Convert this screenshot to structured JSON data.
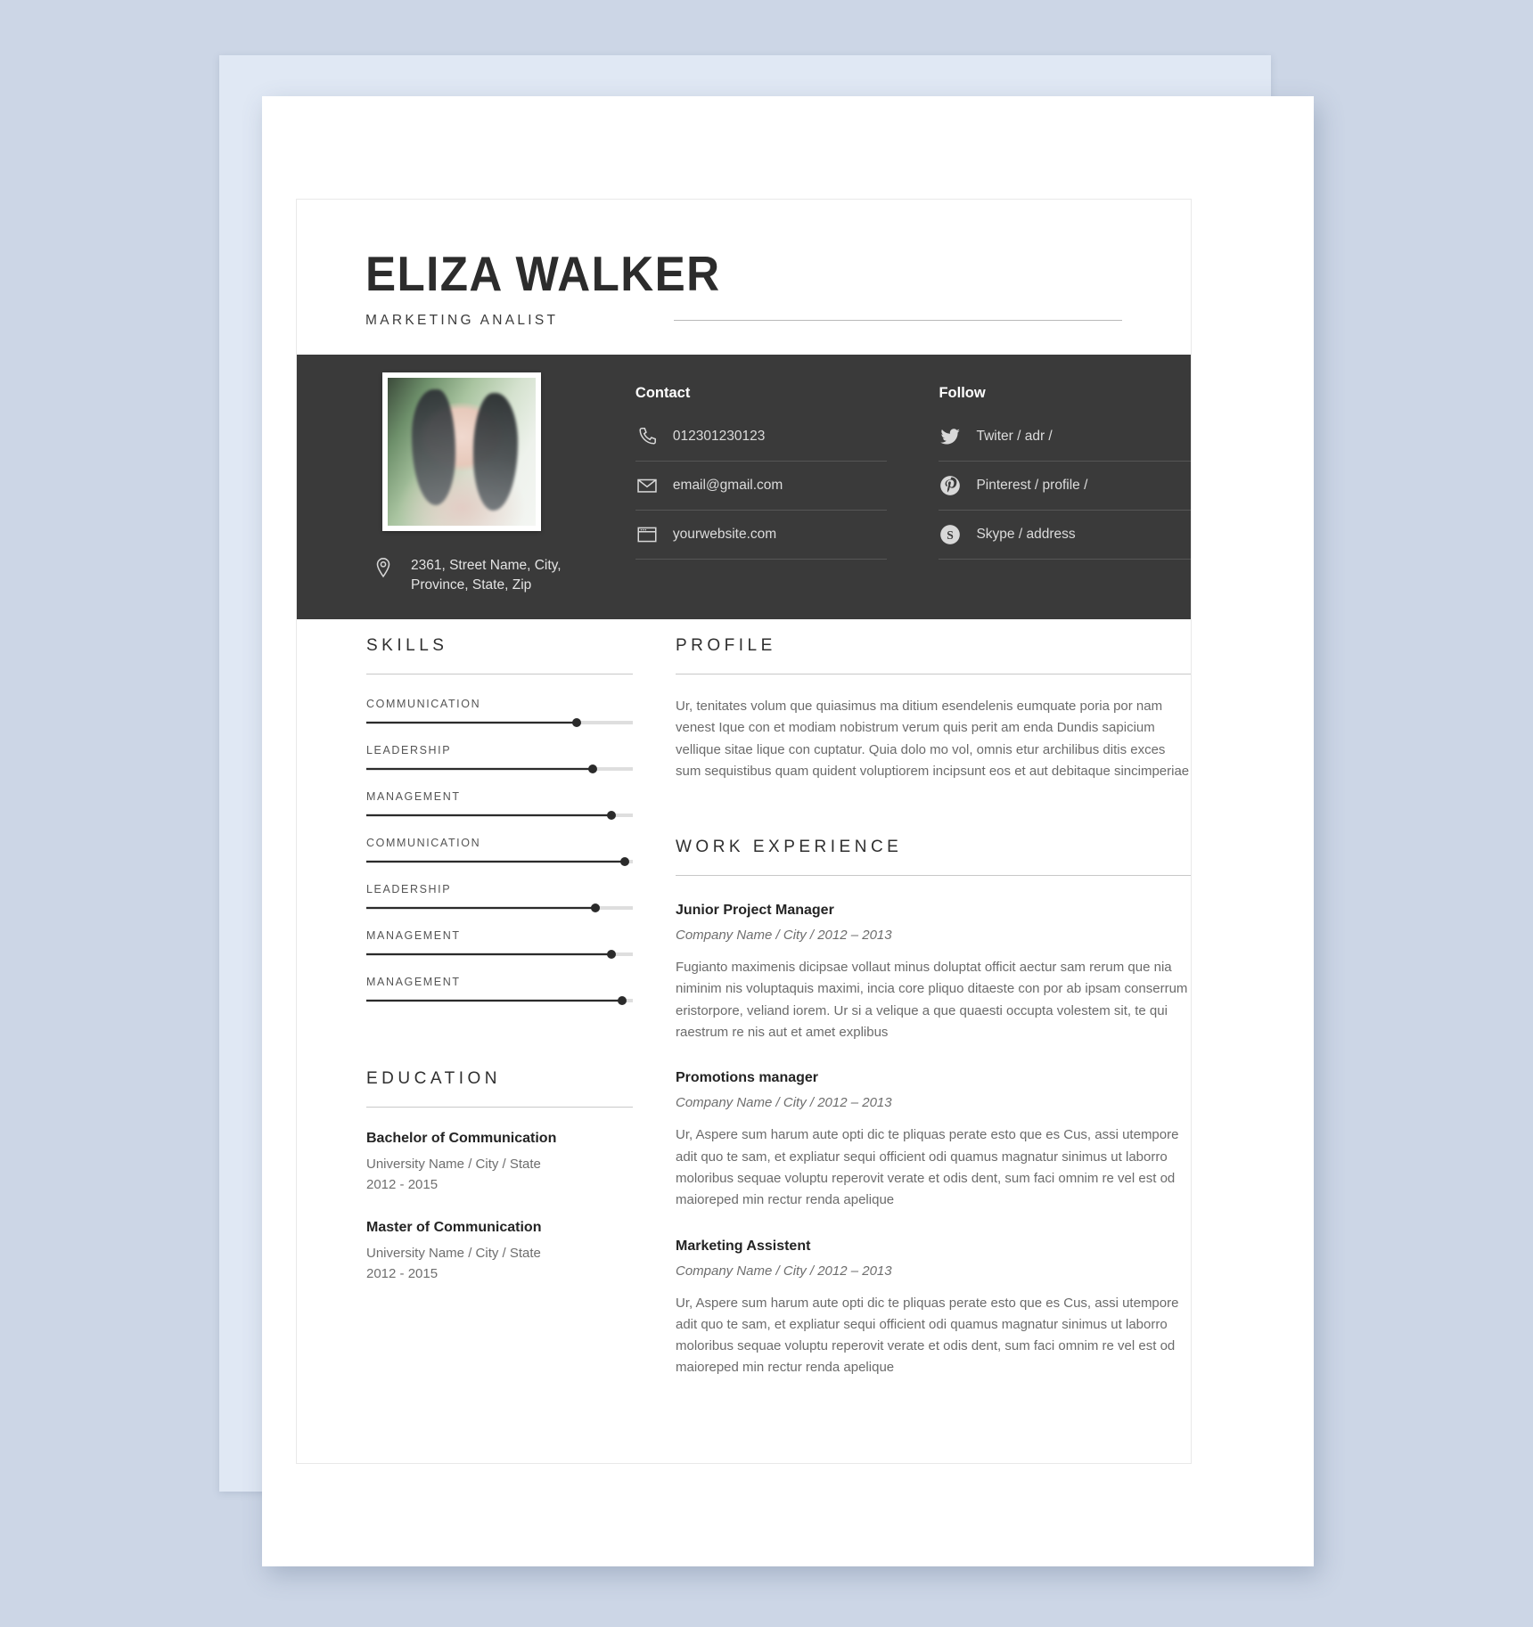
{
  "theme": {
    "page_background": "#ccd6e6",
    "back_sheet": "#e0e8f4",
    "paper": "#ffffff",
    "band_dark": "#3a3a3a",
    "text_dark": "#242424",
    "text_muted": "#6b6b6b",
    "rule": "#c8c8c8"
  },
  "header": {
    "name": "ELIZA WALKER",
    "role": "MARKETING ANALIST"
  },
  "contact": {
    "heading": "Contact",
    "items": [
      {
        "icon": "phone-icon",
        "value": "012301230123"
      },
      {
        "icon": "envelope-icon",
        "value": "email@gmail.com"
      },
      {
        "icon": "browser-window-icon",
        "value": "yourwebsite.com"
      }
    ]
  },
  "follow": {
    "heading": "Follow",
    "items": [
      {
        "icon": "twitter-icon",
        "value": "Twiter / adr /"
      },
      {
        "icon": "pinterest-icon",
        "value": "Pinterest  / profile /"
      },
      {
        "icon": "skype-icon",
        "value": "Skype / address"
      }
    ]
  },
  "address": {
    "icon": "location-pin-icon",
    "line1": "2361, Street Name, City,",
    "line2": "Province, State, Zip"
  },
  "skills": {
    "title": "SKILLS",
    "items": [
      {
        "label": "COMMUNICATION",
        "level": 79
      },
      {
        "label": "LEADERSHIP",
        "level": 85
      },
      {
        "label": "MANAGEMENT",
        "level": 92
      },
      {
        "label": "COMMUNICATION",
        "level": 97
      },
      {
        "label": "LEADERSHIP",
        "level": 86
      },
      {
        "label": "MANAGEMENT",
        "level": 92
      },
      {
        "label": "MANAGEMENT",
        "level": 96
      }
    ]
  },
  "education": {
    "title": "EDUCATION",
    "items": [
      {
        "degree": "Bachelor of Communication",
        "school": "University Name / City / State",
        "years": "2012 - 2015"
      },
      {
        "degree": "Master of Communication",
        "school": "University Name / City / State",
        "years": "2012 - 2015"
      }
    ]
  },
  "profile": {
    "title": "PROFILE",
    "text": "Ur, tenitates volum que quiasimus ma ditium esendelenis eumquate poria por nam venest Ique con et modiam nobistrum verum quis perit am enda Dundis sapicium vellique sitae lique con cuptatur. Quia dolo mo vol, omnis etur archilibus ditis exces sum sequistibus quam quident voluptiorem incipsunt eos et aut debitaque sincimperiae"
  },
  "work": {
    "title": "WORK EXPERIENCE",
    "jobs": [
      {
        "title": "Junior Project Manager",
        "meta": "Company Name / City / 2012 – 2013",
        "desc": "Fugianto maximenis dicipsae vollaut minus doluptat officit aectur sam rerum que nia niminim nis voluptaquis maximi, incia core pliquo ditaeste con por ab ipsam conserrum eristorpore, veliand iorem. Ur si a velique a que quaesti occupta volestem sit, te qui raestrum re nis aut et amet explibus"
      },
      {
        "title": "Promotions manager",
        "meta": "Company Name / City / 2012 – 2013",
        "desc": "Ur, Aspere sum harum aute opti dic te pliquas perate esto que es Cus, assi utempore adit quo te sam, et expliatur sequi officient odi quamus magnatur sinimus ut laborro moloribus sequae voluptu reperovit verate et odis dent, sum faci omnim re vel est od maioreped min rectur renda apelique"
      },
      {
        "title": "Marketing Assistent",
        "meta": "Company Name / City / 2012 – 2013",
        "desc": "Ur, Aspere sum harum aute opti dic te pliquas perate esto que es Cus, assi utempore adit quo te sam, et expliatur sequi officient odi quamus magnatur sinimus ut laborro moloribus sequae voluptu reperovit verate et odis dent, sum faci omnim re vel est od maioreped min rectur renda apelique"
      }
    ]
  }
}
